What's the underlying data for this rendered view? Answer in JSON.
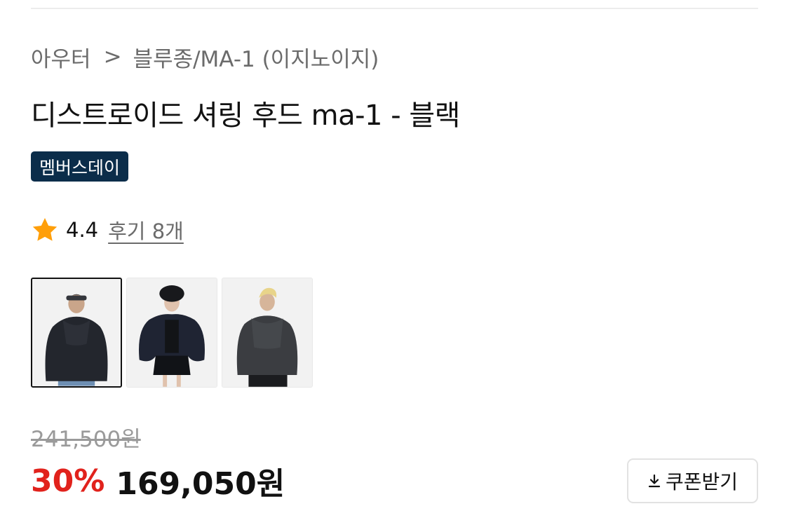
{
  "breadcrumb": {
    "category": "아우터",
    "separator": ">",
    "subcategory": "블루종/MA-1 (이지노이지)"
  },
  "product": {
    "title": "디스트로이드 셔링 후드 ma-1 - 블랙",
    "badge": "멤버스데이",
    "rating": "4.4",
    "reviews_link": "후기 8개"
  },
  "gallery": {
    "thumbnails": [
      {
        "name": "model wearing black hooded ma-1 jacket with cap and jeans",
        "selected": true
      },
      {
        "name": "model wearing black hooded ma-1 jacket with fur hat and skirt",
        "selected": false
      },
      {
        "name": "model wearing charcoal hooded ma-1 jacket",
        "selected": false
      }
    ]
  },
  "price": {
    "original": "241,500원",
    "discount": "30%",
    "sale": "169,050원"
  },
  "coupon": {
    "label": "쿠폰받기",
    "icon": "download-icon"
  },
  "colors": {
    "badge_bg": "#0b2d4a",
    "discount": "#e1221c",
    "star": "#ff9f0a"
  }
}
